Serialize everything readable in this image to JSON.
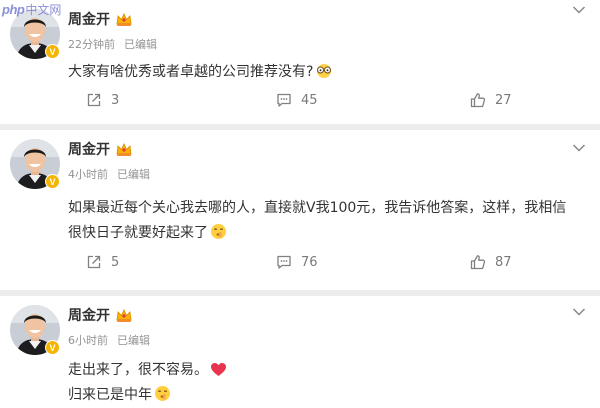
{
  "watermark": {
    "latin": "php",
    "chinese": "中文网"
  },
  "posts": [
    {
      "author": "周金开",
      "time": "22分钟前",
      "edited": "已编辑",
      "content_lines": [
        "大家有啥优秀或者卓越的公司推荐没有?"
      ],
      "emoji": "thinking-glasses-emoji",
      "reposts": "3",
      "comments": "45",
      "likes": "27"
    },
    {
      "author": "周金开",
      "time": "4小时前",
      "edited": "已编辑",
      "content_lines": [
        "如果最近每个关心我去哪的人，直接就V我100元，我告诉他答案，这样，我相信",
        "很快日子就要好起来了"
      ],
      "emoji": "shushing-face-emoji",
      "reposts": "5",
      "comments": "76",
      "likes": "87"
    },
    {
      "author": "周金开",
      "time": "6小时前",
      "edited": "已编辑",
      "content_lines": [
        "走出来了，很不容易。",
        "归来已是中年"
      ],
      "emoji_line1": "red-heart-emoji",
      "emoji_line2": "shushing-face-emoji"
    }
  ],
  "colors": {
    "text": "#333333",
    "meta": "#939393",
    "badge": "#f5b400",
    "heart": "#e8344e",
    "background": "#ececec"
  }
}
